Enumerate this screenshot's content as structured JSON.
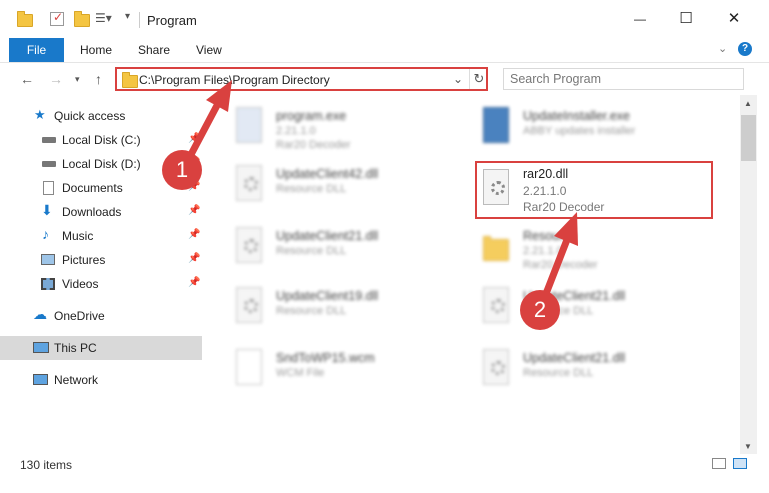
{
  "window": {
    "title": "Program",
    "minimize": "—",
    "maximize": "☐",
    "close": "✕"
  },
  "ribbon": {
    "file": "File",
    "home": "Home",
    "share": "Share",
    "view": "View"
  },
  "address": {
    "path": "C:\\Program Files\\Program Directory",
    "search_placeholder": "Search Program"
  },
  "sidebar": {
    "items": [
      {
        "label": "Quick access",
        "icon": "star-icon"
      },
      {
        "label": "Local Disk (C:)",
        "icon": "drive-icon"
      },
      {
        "label": "Local Disk (D:)",
        "icon": "drive-icon"
      },
      {
        "label": "Documents",
        "icon": "documents-icon"
      },
      {
        "label": "Downloads",
        "icon": "download-icon"
      },
      {
        "label": "Music",
        "icon": "music-icon"
      },
      {
        "label": "Pictures",
        "icon": "pictures-icon"
      },
      {
        "label": "Videos",
        "icon": "videos-icon"
      },
      {
        "label": "OneDrive",
        "icon": "cloud-icon"
      },
      {
        "label": "This PC",
        "icon": "computer-icon"
      },
      {
        "label": "Network",
        "icon": "network-icon"
      }
    ]
  },
  "files": [
    {
      "name": "program.exe",
      "line1": "2.21.1.0",
      "line2": "Rar20 Decoder"
    },
    {
      "name": "UpdateInstaller.exe",
      "line1": "ABBY updates installer",
      "line2": ""
    },
    {
      "name": "UpdateClient42.dll",
      "line1": "Resource DLL",
      "line2": ""
    },
    {
      "name": "rar20.dll",
      "line1": "2.21.1.0",
      "line2": "Rar20 Decoder"
    },
    {
      "name": "UpdateClient21.dll",
      "line1": "Resource DLL",
      "line2": ""
    },
    {
      "name": "Resource",
      "line1": "2.21.1.0",
      "line2": "Rar20 Decoder"
    },
    {
      "name": "UpdateClient19.dll",
      "line1": "Resource DLL",
      "line2": ""
    },
    {
      "name": "UpdateClient21.dll",
      "line1": "Resource DLL",
      "line2": ""
    },
    {
      "name": "SndToWP15.wcm",
      "line1": "WCM File",
      "line2": ""
    },
    {
      "name": "UpdateClient21.dll",
      "line1": "Resource DLL",
      "line2": ""
    }
  ],
  "status": {
    "count": "130 items"
  },
  "badges": {
    "step1": "1",
    "step2": "2"
  },
  "colors": {
    "accent": "#1979ca",
    "highlight": "#d9413f"
  }
}
